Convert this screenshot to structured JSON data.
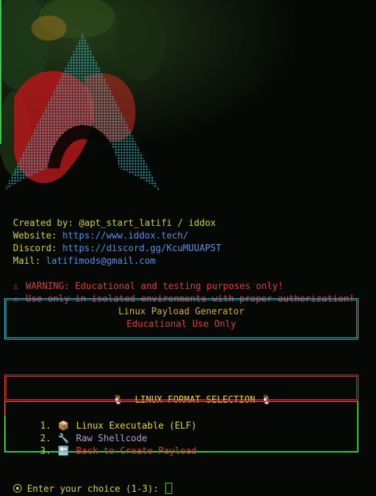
{
  "credits": {
    "created_label": "Created by:",
    "created_value": "@apt_start_latifi / iddox",
    "website_label": "Website:",
    "website_value": "https://www.iddox.tech/",
    "discord_label": "Discord:",
    "discord_value": "https://discord.gg/KcuMUUAP5T",
    "mail_label": "Mail:",
    "mail_value": "latifimods@gmail.com"
  },
  "warnings": [
    {
      "icon": "⚠",
      "text": "WARNING: Educational and testing purposes only!"
    },
    {
      "icon": "⚠",
      "text": "Use only in isolated environments with proper authorization!"
    }
  ],
  "banner": {
    "title": "Linux Payload Generator",
    "subtitle": "Educational Use Only"
  },
  "section": {
    "icon_left": "🐧",
    "title": "LINUX FORMAT SELECTION",
    "icon_right": "🐧"
  },
  "menu": [
    {
      "num": "1.",
      "icon": "📦",
      "label": "Linux Executable (ELF)"
    },
    {
      "num": "2.",
      "icon": "🔧",
      "label": "Raw Shellcode"
    },
    {
      "num": "3.",
      "icon": "🔙",
      "label": "Back to Create Payload"
    }
  ],
  "prompt": {
    "text": "Enter your choice (1-3):"
  },
  "colors": {
    "background": "#050805",
    "accent_yellow": "#cfd33a",
    "link_blue": "#5b8ee6",
    "warning_red": "#e23b3b",
    "frame_cyan": "#37b6c6",
    "frame_green": "#2fd14a"
  }
}
